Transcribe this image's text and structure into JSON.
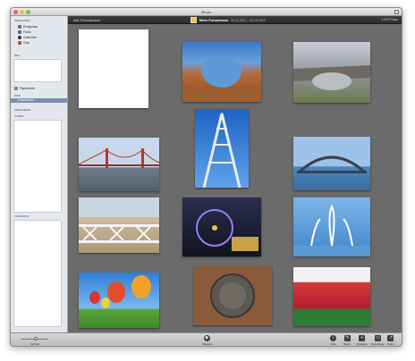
{
  "window": {
    "title": "iPhoto"
  },
  "sidebar": {
    "library_header": "MEDIATHEK",
    "library_items": [
      {
        "label": "Ereignisse",
        "icon": "events-icon"
      },
      {
        "label": "Fotos",
        "icon": "photos-icon"
      },
      {
        "label": "Gesichter",
        "icon": "faces-icon"
      },
      {
        "label": "Orte",
        "icon": "places-icon"
      }
    ],
    "recent_header": "NEU",
    "trash_label": "Papierkorb",
    "web_header": "WEB",
    "web_selected_label": "Fotostream",
    "albums_header": "EREIGNISSE",
    "alben_header": "ALBEN",
    "projects_header": "PROJEKTE"
  },
  "topbar": {
    "back_label": "Alle Fotostreams",
    "event_title": "Mein Fotostream",
    "event_date": "08.12.2012 – 05.03.2013",
    "photo_count": "1.000 Fotos"
  },
  "toolbar": {
    "search_label": "Suchen",
    "slideshow_label": "Diashow",
    "info_label": "Infos",
    "edit_label": "Bearb.",
    "create_label": "Erstellen",
    "add_label": "Hinzufügen",
    "share_label": "Teilen"
  },
  "colors": {
    "grid_background": "#6b6b6b",
    "sidebar_background": "#e4e8ee",
    "selection": "#7a8fb0",
    "toolbar": "#c8c8c8"
  }
}
